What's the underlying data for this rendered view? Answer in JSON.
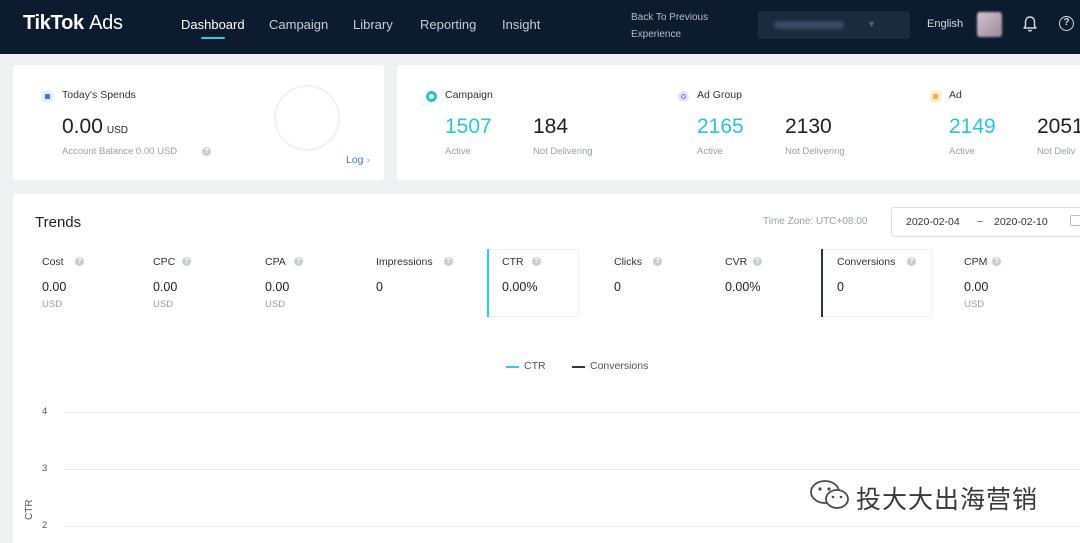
{
  "app": {
    "logo_main": "TikTok",
    "logo_sub": "Ads"
  },
  "nav": {
    "items": [
      "Dashboard",
      "Campaign",
      "Library",
      "Reporting",
      "Insight"
    ],
    "active": "Dashboard",
    "back_line1": "Back To Previous",
    "back_line2": "Experience",
    "language": "English"
  },
  "spend_card": {
    "title": "Today's Spends",
    "value": "0.00",
    "unit": "USD",
    "balance": "Account Balance 0.00 USD",
    "log_label": "Log",
    "icon": "square-dot-icon",
    "icon_color": "#3b79d6"
  },
  "summary": {
    "campaign": {
      "title": "Campaign",
      "active": "1507",
      "active_label": "Active",
      "not_delivering": "184",
      "not_delivering_label": "Not Delivering",
      "icon_color": "#25c3d0"
    },
    "ad_group": {
      "title": "Ad Group",
      "active": "2165",
      "active_label": "Active",
      "not_delivering": "2130",
      "not_delivering_label": "Not Delivering",
      "icon_color": "#7b6fd6"
    },
    "ad": {
      "title": "Ad",
      "active": "2149",
      "active_label": "Active",
      "not_delivering": "2051",
      "not_delivering_label": "Not Deliv",
      "icon_color": "#f2b23c"
    }
  },
  "trends": {
    "title": "Trends",
    "timezone": "Time Zone: UTC+08:00",
    "date_start": "2020-02-04",
    "date_sep": "~",
    "date_end": "2020-02-10",
    "metrics": [
      {
        "label": "Cost",
        "value": "0.00",
        "unit": "USD"
      },
      {
        "label": "CPC",
        "value": "0.00",
        "unit": "USD"
      },
      {
        "label": "CPA",
        "value": "0.00",
        "unit": "USD"
      },
      {
        "label": "Impressions",
        "value": "0",
        "unit": ""
      },
      {
        "label": "CTR",
        "value": "0.00%",
        "unit": ""
      },
      {
        "label": "Clicks",
        "value": "0",
        "unit": ""
      },
      {
        "label": "CVR",
        "value": "0.00%",
        "unit": ""
      },
      {
        "label": "Conversions",
        "value": "0",
        "unit": ""
      },
      {
        "label": "CPM",
        "value": "0.00",
        "unit": "USD"
      }
    ],
    "selected_colors": {
      "CTR": "#25d0e0",
      "Conversions": "#2d3441"
    }
  },
  "chart_data": {
    "type": "line",
    "series": [
      {
        "name": "CTR",
        "color": "#25d0e0",
        "values": []
      },
      {
        "name": "Conversions",
        "color": "#2d3441",
        "values": []
      }
    ],
    "ylabel": "CTR",
    "y_ticks": [
      "4",
      "3",
      "2"
    ],
    "legend_placement": "top-center",
    "grid": true
  },
  "watermark": {
    "text": "投大大出海营销"
  }
}
